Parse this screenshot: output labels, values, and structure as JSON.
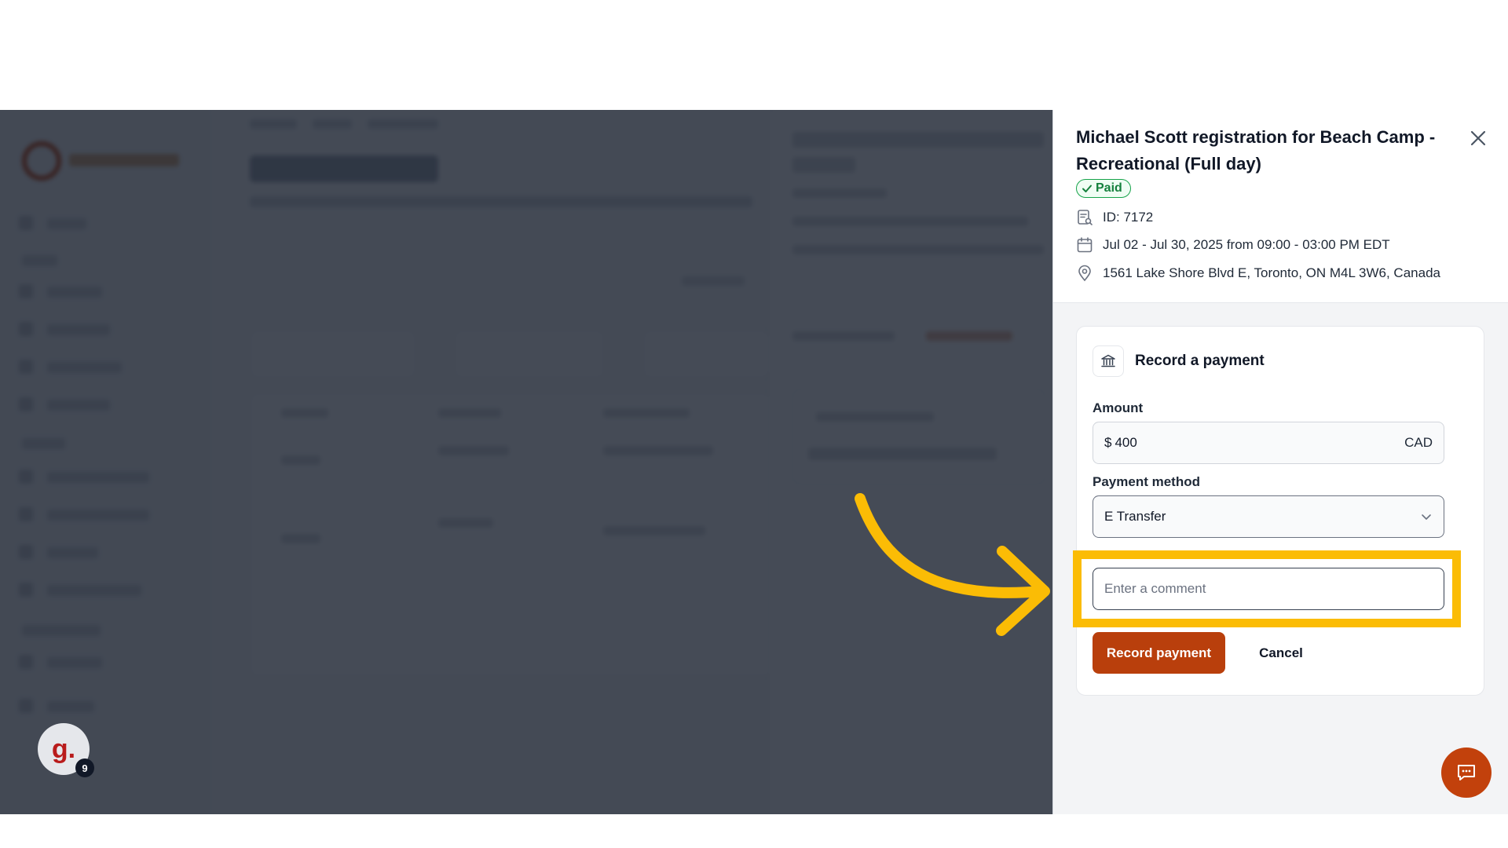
{
  "drawer": {
    "title": "Michael Scott registration for Beach Camp - Recreational (Full day)",
    "status_badge": "Paid",
    "id_text": "ID: 7172",
    "date_text": "Jul 02 - Jul 30, 2025 from 09:00 - 03:00 PM EDT",
    "location_text": "1561 Lake Shore Blvd E, Toronto, ON M4L 3W6, Canada"
  },
  "payment_form": {
    "title": "Record a payment",
    "amount_label": "Amount",
    "currency_symbol": "$",
    "amount_value": "400",
    "currency_code": "CAD",
    "method_label": "Payment method",
    "method_value": "E Transfer",
    "comment_placeholder": "Enter a comment",
    "submit_label": "Record payment",
    "cancel_label": "Cancel"
  },
  "widgets": {
    "avatar_letter": "g.",
    "avatar_count": "9"
  },
  "colors": {
    "primary": "#b93f0c",
    "paid_green": "#16a34a",
    "highlight": "#fbbc05"
  },
  "icons": {
    "close": "close-icon",
    "id": "receipt-search-icon",
    "date": "calendar-icon",
    "location": "map-pin-icon",
    "bank": "bank-icon",
    "select": "chevron-down-icon",
    "chat": "chat-icon"
  }
}
